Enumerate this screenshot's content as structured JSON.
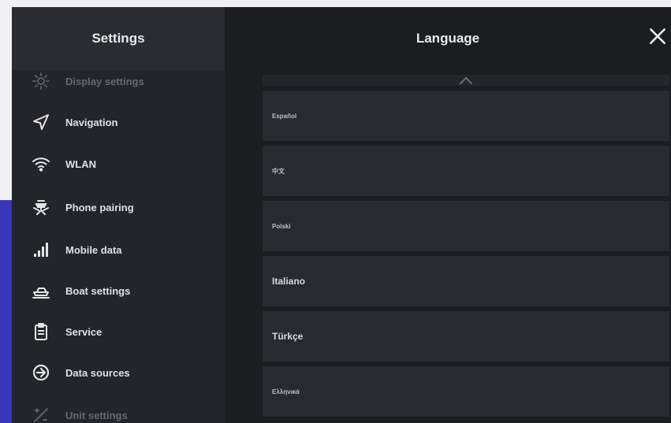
{
  "sidebar": {
    "title": "Settings",
    "items": [
      {
        "id": "display",
        "label": "Display settings",
        "icon": "sun-icon"
      },
      {
        "id": "navigation",
        "label": "Navigation",
        "icon": "navigation-arrow-icon"
      },
      {
        "id": "wlan",
        "label": "WLAN",
        "icon": "wifi-icon"
      },
      {
        "id": "phone",
        "label": "Phone pairing",
        "icon": "satellite-icon"
      },
      {
        "id": "mobile",
        "label": "Mobile data",
        "icon": "signal-bars-icon"
      },
      {
        "id": "boat",
        "label": "Boat settings",
        "icon": "boat-icon"
      },
      {
        "id": "service",
        "label": "Service",
        "icon": "clipboard-icon"
      },
      {
        "id": "data-sources",
        "label": "Data sources",
        "icon": "data-source-icon"
      },
      {
        "id": "unit",
        "label": "Unit settings",
        "icon": "units-icon"
      }
    ]
  },
  "main": {
    "title": "Language",
    "close_icon": "close-icon",
    "scroll_up_icon": "chevron-up-icon",
    "languages": [
      {
        "label": "Español",
        "size": "small"
      },
      {
        "label": "中文",
        "size": "small"
      },
      {
        "label": "Polski",
        "size": "small"
      },
      {
        "label": "Italiano",
        "size": "normal"
      },
      {
        "label": "Türkçe",
        "size": "normal"
      },
      {
        "label": "Ελληνικά",
        "size": "small"
      }
    ]
  },
  "colors": {
    "accent": "#3a36b8",
    "background": "#1b1d21",
    "sidebar": "#22252a",
    "item": "#272a2f"
  }
}
